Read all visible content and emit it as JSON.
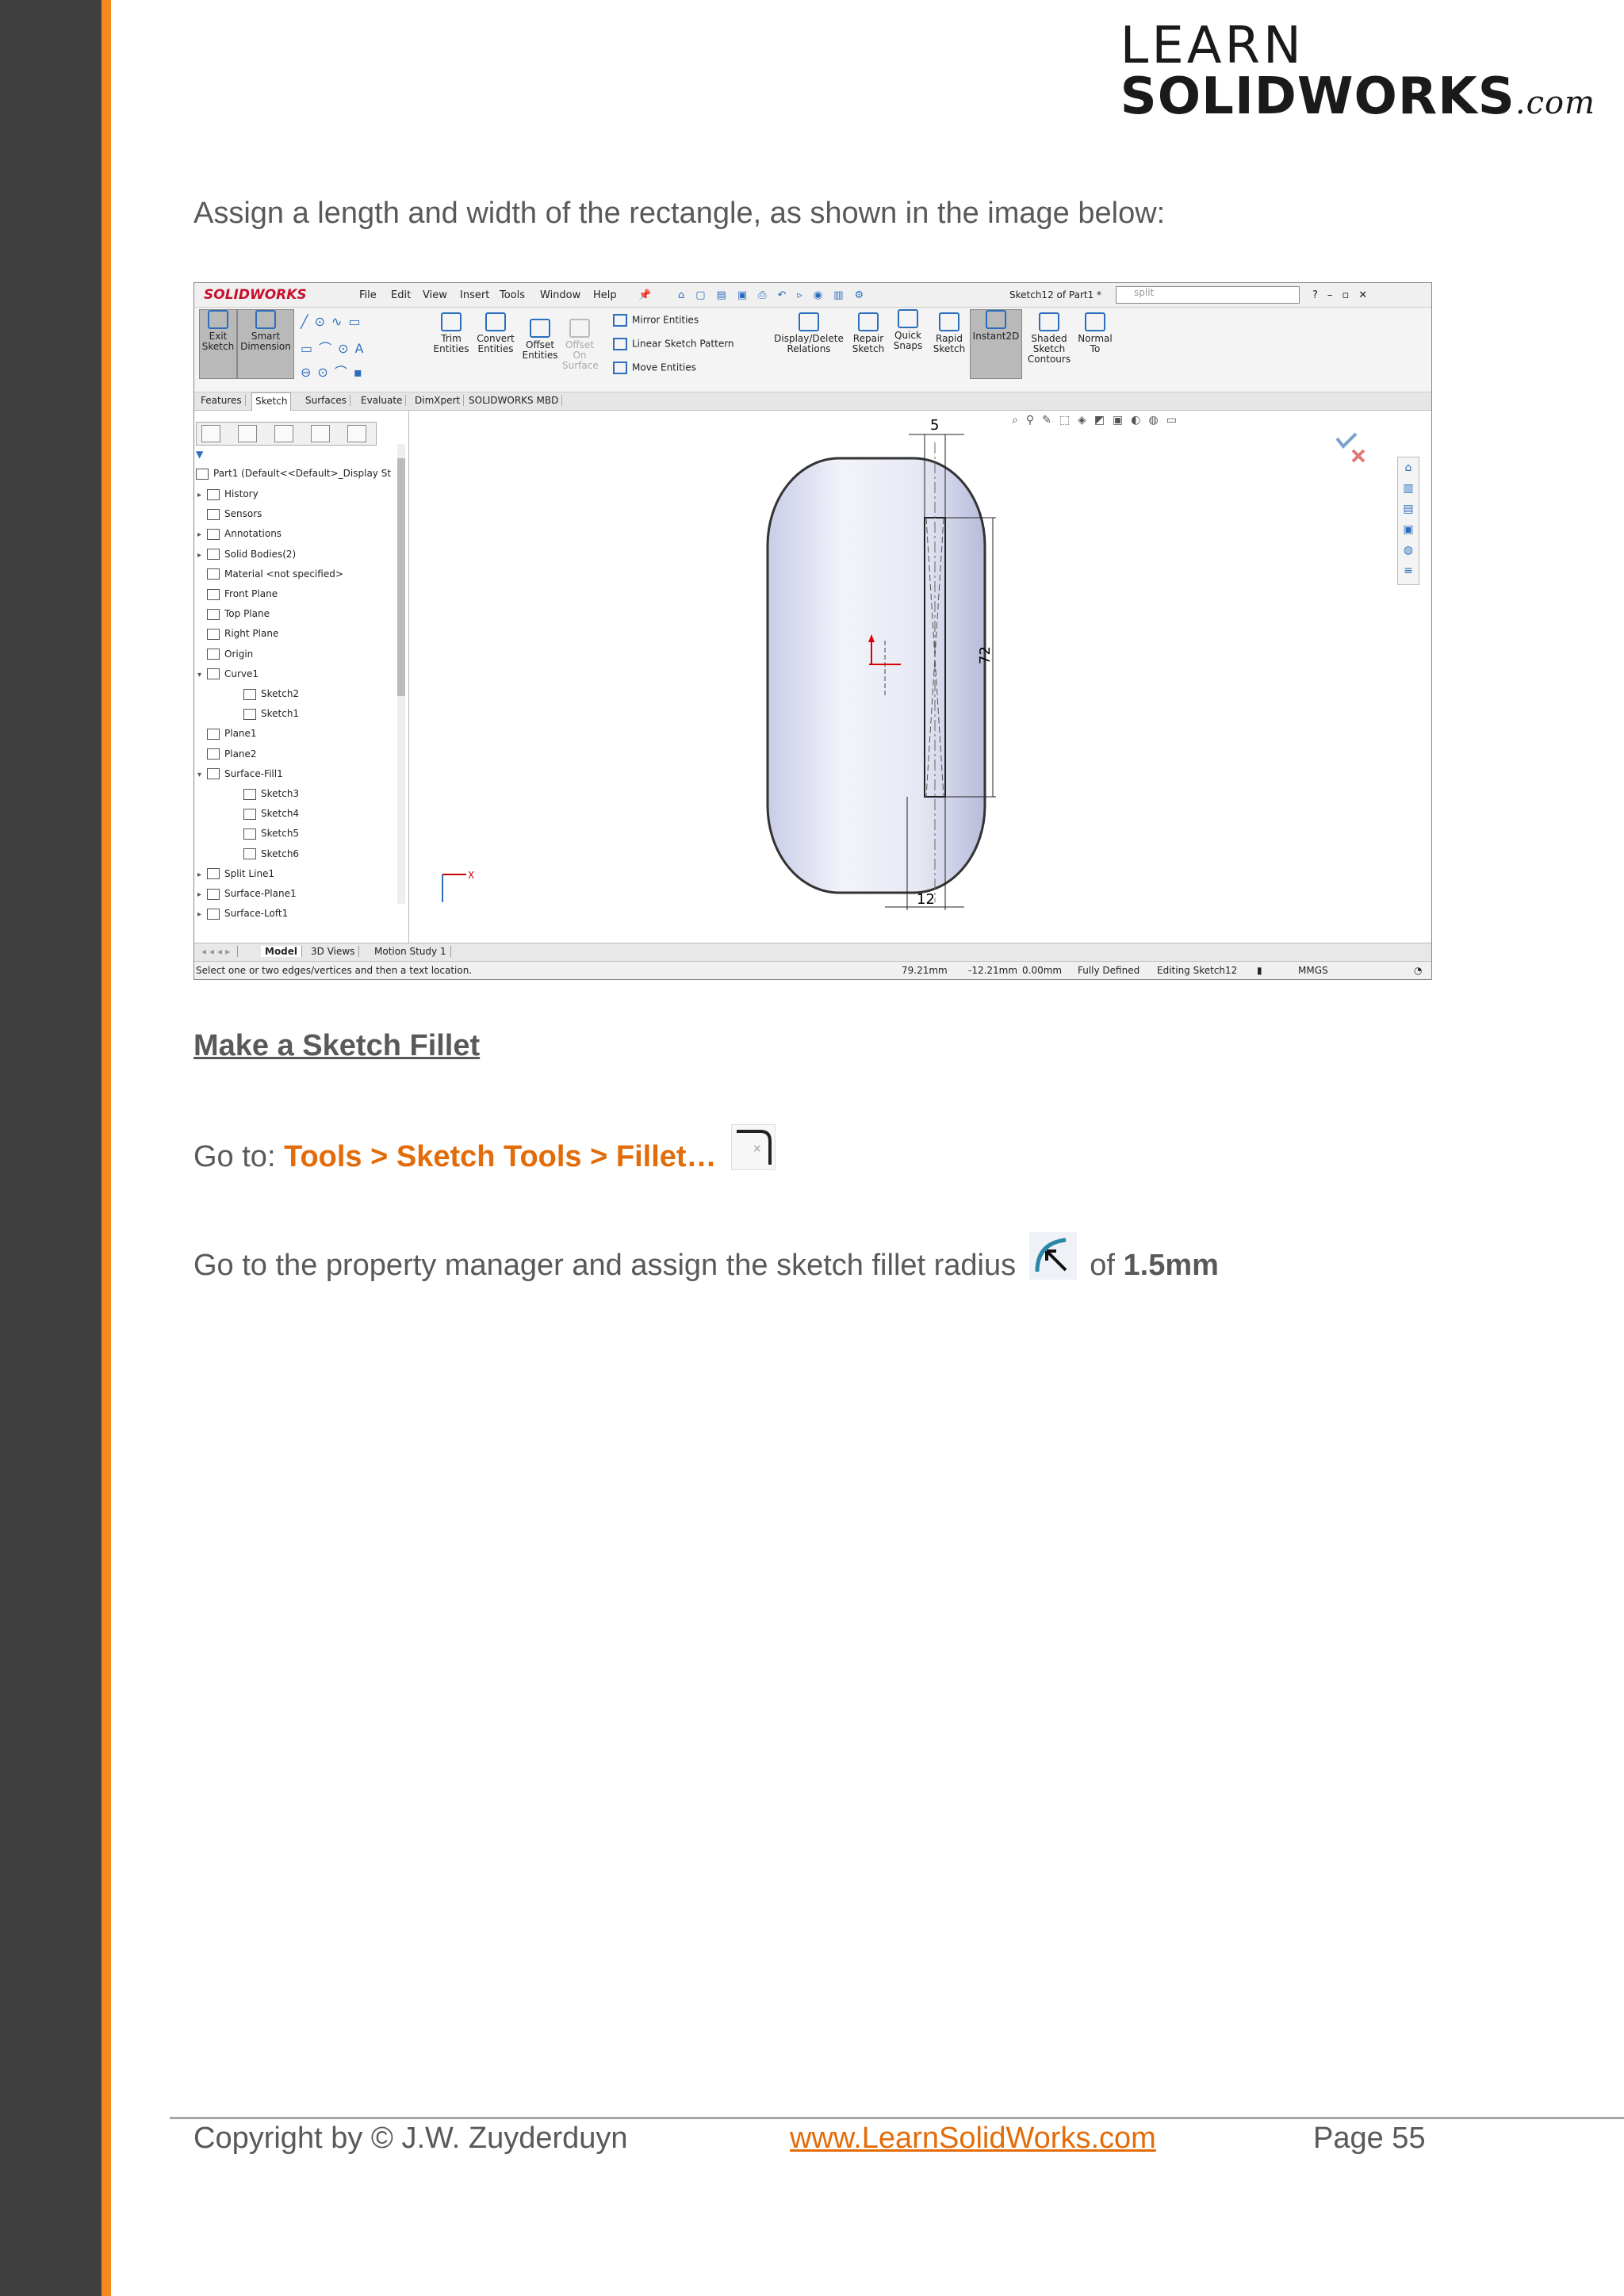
{
  "logo": {
    "line1": "LEARN",
    "line2": "SOLIDWORKS",
    "suffix": ".com"
  },
  "intro_text": "Assign a length and width of the rectangle, as shown in the image below:",
  "screenshot": {
    "brand": "SOLIDWORKS",
    "menu": [
      "File",
      "Edit",
      "View",
      "Insert",
      "Tools",
      "Window",
      "Help"
    ],
    "doc_title": "Sketch12 of Part1 *",
    "search_value": "split",
    "ribbon": {
      "exit_sketch": "Exit Sketch",
      "smart_dimension": "Smart Dimension",
      "trim_entities": "Trim Entities",
      "convert_entities": "Convert Entities",
      "offset_entities": "Offset Entities",
      "offset_on_surface": "Offset On Surface",
      "mirror_entities": "Mirror Entities",
      "linear_sketch_pattern": "Linear Sketch Pattern",
      "move_entities": "Move Entities",
      "display_delete_relations": "Display/Delete Relations",
      "repair_sketch": "Repair Sketch",
      "quick_snaps": "Quick Snaps",
      "rapid_sketch": "Rapid Sketch",
      "instant2d": "Instant2D",
      "shaded_sketch_contours": "Shaded Sketch Contours",
      "normal_to": "Normal To"
    },
    "cm_tabs": [
      "Features",
      "Sketch",
      "Surfaces",
      "Evaluate",
      "DimXpert",
      "SOLIDWORKS MBD"
    ],
    "active_cm_tab": "Sketch",
    "tree_root": "Part1  (Default<<Default>_Display St",
    "tree_items": [
      "History",
      "Sensors",
      "Annotations",
      "Solid Bodies(2)",
      "Material <not specified>",
      "Front Plane",
      "Top Plane",
      "Right Plane",
      "Origin",
      "Curve1",
      "Sketch2",
      "Sketch1",
      "Plane1",
      "Plane2",
      "Surface-Fill1",
      "Sketch3",
      "Sketch4",
      "Sketch5",
      "Sketch6",
      "Split Line1",
      "Surface-Plane1",
      "Surface-Loft1"
    ],
    "dimensions": {
      "top": "5",
      "right": "72",
      "bottom": "12"
    },
    "axis_label": "X",
    "bottom_tabs": [
      "Model",
      "3D Views",
      "Motion Study 1"
    ],
    "status": {
      "hint": "Select one or two edges/vertices and then a text location.",
      "x": "79.21mm",
      "y": "-12.21mm",
      "z": "0.00mm",
      "state": "Fully Defined",
      "editing": "Editing Sketch12",
      "units": "MMGS"
    }
  },
  "heading": "Make a Sketch Fillet",
  "goto_prefix": "Go to: ",
  "goto_path": "Tools > Sketch Tools > Fillet…",
  "radius_prefix": "Go to the property manager and assign the sketch fillet radius",
  "radius_of": "of",
  "radius_value": "1.5mm",
  "footer": {
    "copyright": "Copyright by © J.W. Zuyderduyn",
    "link": "www.LearnSolidWorks.com",
    "page": "Page 55"
  }
}
